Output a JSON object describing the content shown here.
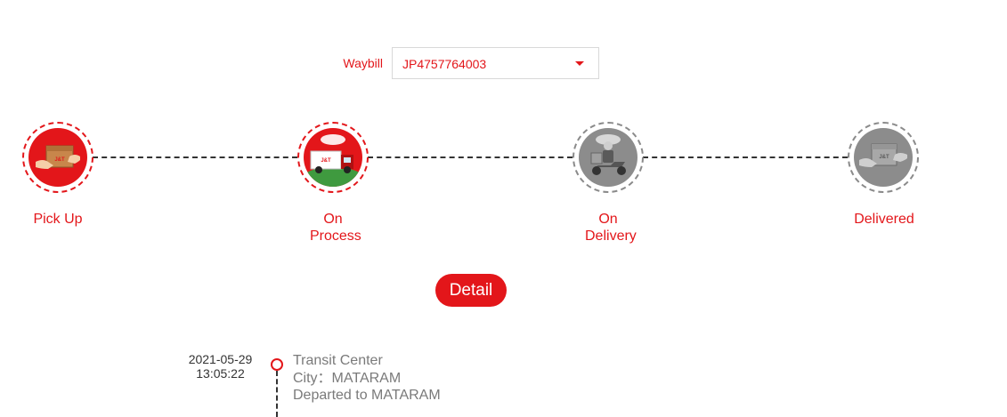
{
  "waybill": {
    "label": "Waybill",
    "selected": "JP4757764003"
  },
  "steps": [
    {
      "label": "Pick Up",
      "icon": "package-handover-icon",
      "status": "done"
    },
    {
      "label": "On Process",
      "icon": "delivery-truck-icon",
      "status": "done"
    },
    {
      "label": "On Delivery",
      "icon": "courier-scooter-icon",
      "status": "pending"
    },
    {
      "label": "Delivered",
      "icon": "package-received-icon",
      "status": "pending"
    }
  ],
  "detail_button": "Detail",
  "timeline": [
    {
      "date": "2021-05-29",
      "time": "13:05:22",
      "title": "Transit Center",
      "city": "City：MATARAM",
      "description": "Departed to MATARAM"
    }
  ],
  "colors": {
    "accent": "#e3161a",
    "inactive": "#8c8c8c",
    "muted_text": "#7a7a7a"
  }
}
